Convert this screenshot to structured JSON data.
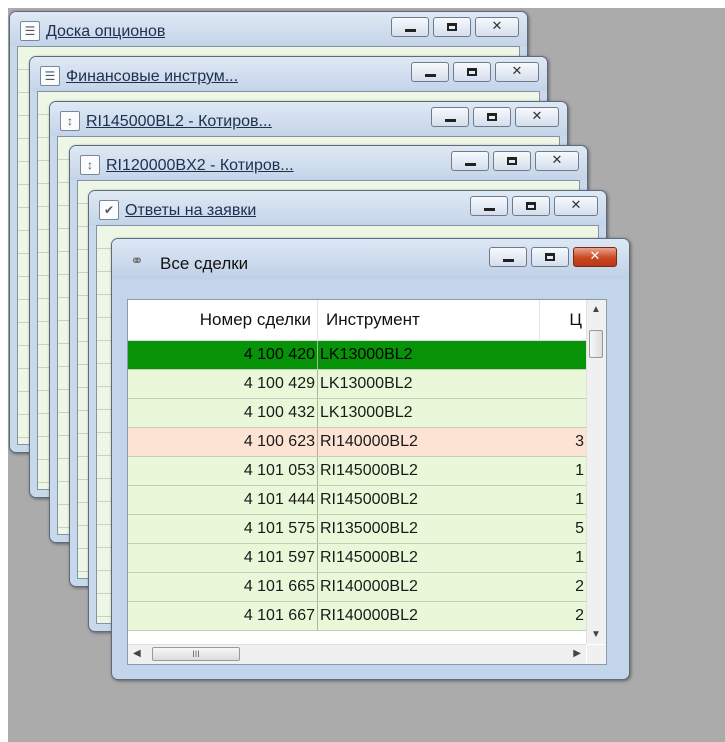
{
  "windows": {
    "w1": {
      "title": "Доска опционов",
      "icon": "list-icon"
    },
    "w2": {
      "title": "Финансовые инструм...",
      "icon": "list-icon"
    },
    "w3": {
      "title": "RI145000BL2 - Котиров...",
      "icon": "quotes-icon"
    },
    "w4": {
      "title": "RI120000BX2 - Котиров...",
      "icon": "quotes-icon"
    },
    "w5": {
      "title": "Ответы на заявки",
      "icon": "checkbox-icon"
    }
  },
  "all_trades": {
    "title": "Все сделки",
    "icon": "handshake-icon",
    "columns": [
      "Номер сделки",
      "Инструмент",
      "Ц"
    ],
    "rows": [
      {
        "id": "4 100 420",
        "instrument": "LK13000BL2",
        "price": "",
        "state": "selected"
      },
      {
        "id": "4 100 429",
        "instrument": "LK13000BL2",
        "price": "",
        "state": "buy"
      },
      {
        "id": "4 100 432",
        "instrument": "LK13000BL2",
        "price": "",
        "state": "buy"
      },
      {
        "id": "4 100 623",
        "instrument": "RI140000BL2",
        "price": "3",
        "state": "sell"
      },
      {
        "id": "4 101 053",
        "instrument": "RI145000BL2",
        "price": "1",
        "state": "buy"
      },
      {
        "id": "4 101 444",
        "instrument": "RI145000BL2",
        "price": "1",
        "state": "buy"
      },
      {
        "id": "4 101 575",
        "instrument": "RI135000BL2",
        "price": "5",
        "state": "buy"
      },
      {
        "id": "4 101 597",
        "instrument": "RI145000BL2",
        "price": "1",
        "state": "buy"
      },
      {
        "id": "4 101 665",
        "instrument": "RI140000BL2",
        "price": "2",
        "state": "buy"
      },
      {
        "id": "4 101 667",
        "instrument": "RI140000BL2",
        "price": "2",
        "state": "buy"
      }
    ],
    "hscroll_grip": "III"
  },
  "colors": {
    "desktop": "#ababab",
    "selected_row": "#079308",
    "buy_row": "#e8f8d8",
    "sell_row": "#fde3d4",
    "close_button": "#c9461f"
  }
}
